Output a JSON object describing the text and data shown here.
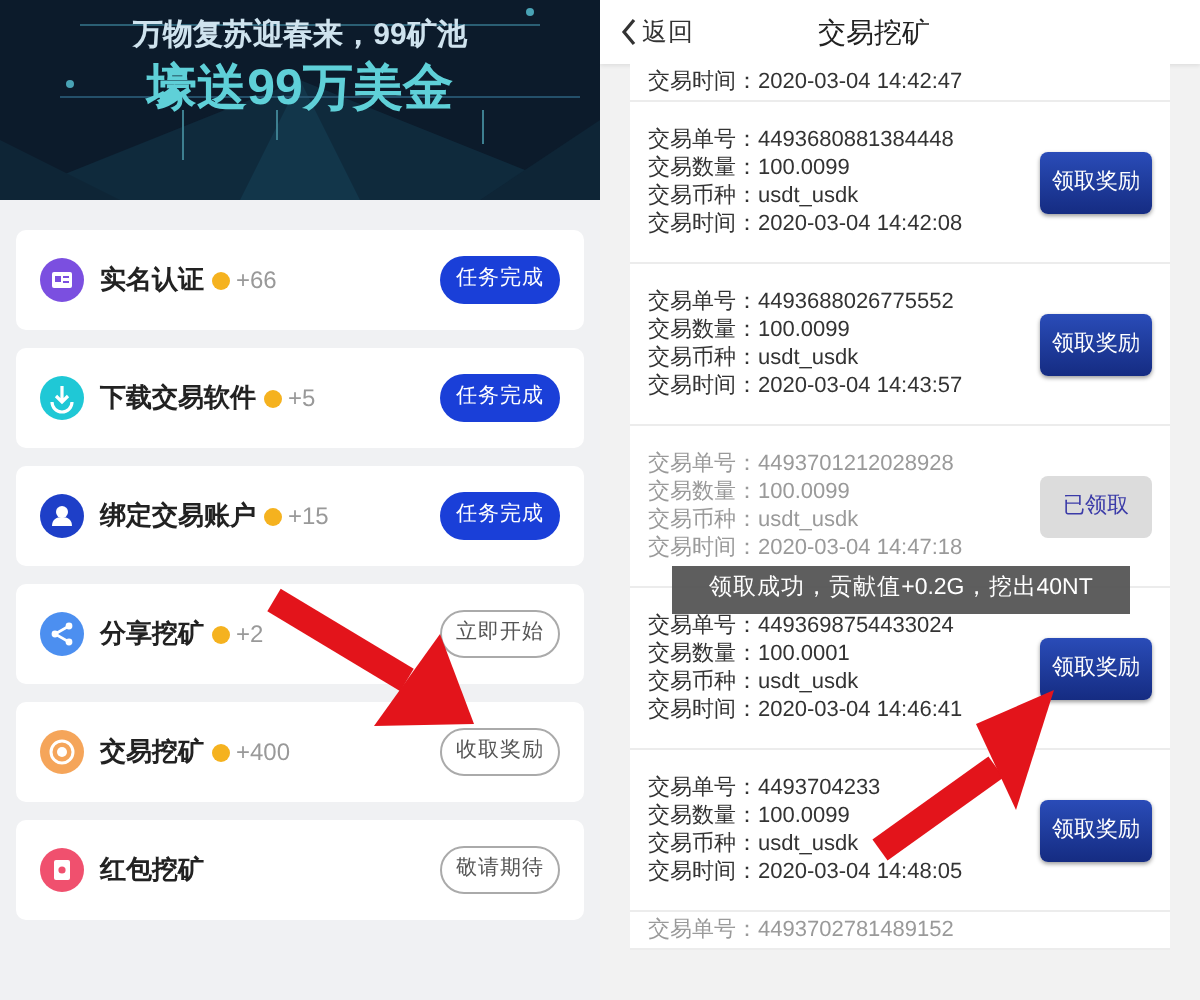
{
  "banner": {
    "line_1": "万物复苏迎春来，99矿池",
    "line_2": "壕送99万美金"
  },
  "tasks": [
    {
      "title": "实名认证",
      "reward": "+66",
      "button": "任务完成",
      "completed": true
    },
    {
      "title": "下载交易软件",
      "reward": "+5",
      "button": "任务完成",
      "completed": true
    },
    {
      "title": "绑定交易账户",
      "reward": "+15",
      "button": "任务完成",
      "completed": true
    },
    {
      "title": "分享挖矿",
      "reward": "+2",
      "button": "立即开始",
      "completed": false
    },
    {
      "title": "交易挖矿",
      "reward": "+400",
      "button": "收取奖励",
      "completed": false
    },
    {
      "title": "红包挖矿",
      "button": "敬请期待",
      "completed": false
    }
  ],
  "header": {
    "back": "返回",
    "title": "交易挖矿"
  },
  "records": [
    {
      "lines": [
        "交易时间：2020-03-04 14:42:47"
      ],
      "claimed": false
    },
    {
      "lines": [
        "交易单号：4493680881384448",
        "交易数量：100.0099",
        "交易币种：usdt_usdk",
        "交易时间：2020-03-04 14:42:08"
      ],
      "button": "领取奖励",
      "claimed": false
    },
    {
      "lines": [
        "交易单号：4493688026775552",
        "交易数量：100.0099",
        "交易币种：usdt_usdk",
        "交易时间：2020-03-04 14:43:57"
      ],
      "button": "领取奖励",
      "claimed": false
    },
    {
      "lines": [
        "交易单号：4493701212028928",
        "交易数量：100.0099",
        "交易币种：usdt_usdk",
        "交易时间：2020-03-04 14:47:18"
      ],
      "button": "已领取",
      "claimed": true
    },
    {
      "lines": [
        "交易单号：4493698754433024",
        "交易数量：100.0001",
        "交易币种：usdt_usdk",
        "交易时间：2020-03-04 14:46:41"
      ],
      "button": "领取奖励",
      "claimed": false
    },
    {
      "lines": [
        "交易单号：4493704233",
        "交易数量：100.0099",
        "交易币种：usdt_usdk",
        "交易时间：2020-03-04 14:48:05"
      ],
      "button": "领取奖励",
      "claimed": false
    },
    {
      "lines": [
        "交易单号：4493702781489152"
      ],
      "claimed": true
    }
  ],
  "toast": "领取成功，贡献值+0.2G，挖出40NT"
}
